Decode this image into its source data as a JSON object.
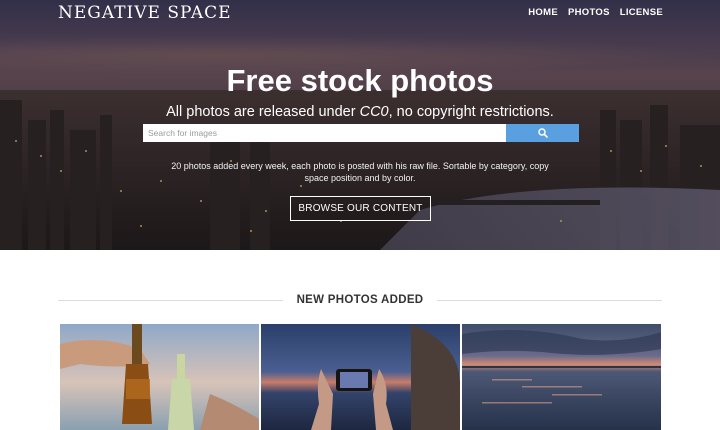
{
  "brand": "NEGATIVE SPACE",
  "nav": [
    {
      "label": "HOME"
    },
    {
      "label": "PHOTOS"
    },
    {
      "label": "LICENSE"
    }
  ],
  "hero": {
    "title": "Free stock photos",
    "subtitle_before": "All photos are released under ",
    "subtitle_em": "CC0",
    "subtitle_after": ", no copyright restrictions.",
    "search_placeholder": "Search for images",
    "search_icon": "search-icon",
    "description": "20 photos added every week, each photo is posted with his raw file. Sortable by category, copy space position and by color.",
    "browse_label": "BROWSE OUR CONTENT"
  },
  "section": {
    "title": "NEW PHOTOS ADDED"
  },
  "colors": {
    "accent": "#5aa0e0"
  }
}
